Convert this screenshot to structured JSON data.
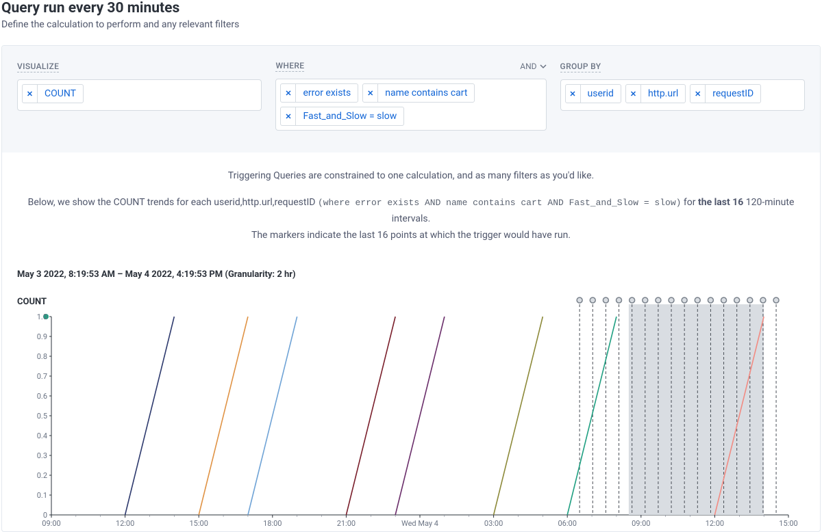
{
  "header": {
    "title": "Query run every 30 minutes",
    "subtitle": "Define the calculation to perform and any relevant filters"
  },
  "query": {
    "visualize_label": "VISUALIZE",
    "where_label": "WHERE",
    "where_op": "AND",
    "group_by_label": "GROUP BY",
    "visualize": [
      {
        "label": "COUNT"
      }
    ],
    "where": [
      {
        "label": "error exists"
      },
      {
        "label": "name contains cart"
      },
      {
        "label": "Fast_and_Slow = slow"
      }
    ],
    "group_by": [
      {
        "label": "userid"
      },
      {
        "label": "http.url"
      },
      {
        "label": "requestID"
      }
    ]
  },
  "explain": {
    "line1": "Triggering Queries are constrained to one calculation, and as many filters as you'd like.",
    "line2_pre": "Below, we show the COUNT trends for each userid,http.url,requestID ",
    "line2_mono": "(where error exists AND name contains cart AND Fast_and_Slow = slow)",
    "line2_mid": "  for ",
    "line2_bold": "the last 16",
    "line2_post": " 120-minute intervals.",
    "line3": "The markers indicate the last 16 points at which the trigger would have run."
  },
  "chart": {
    "range_label": "May 3 2022, 8:19:53 AM – May 4 2022, 4:19:53 PM (Granularity: 2 hr)",
    "y_title": "COUNT",
    "y_ticks": [
      "0",
      "0.1",
      "0.2",
      "0.3",
      "0.4",
      "0.5",
      "0.6",
      "0.7",
      "0.8",
      "0.9",
      "1.0"
    ],
    "x_ticks": [
      "09:00",
      "12:00",
      "15:00",
      "18:00",
      "21:00",
      "Wed May 4",
      "03:00",
      "06:00",
      "09:00",
      "12:00",
      "15:00"
    ]
  },
  "chart_data": {
    "type": "line",
    "title": "COUNT",
    "ylabel": "COUNT",
    "xlabel": "",
    "ylim": [
      0,
      1.0
    ],
    "x_range_label": "May 3 2022, 8:19:53 AM – May 4 2022, 4:19:53 PM",
    "granularity": "2 hr",
    "x_tick_labels": [
      "09:00",
      "12:00",
      "15:00",
      "18:00",
      "21:00",
      "Wed May 4",
      "03:00",
      "06:00",
      "09:00",
      "12:00",
      "15:00"
    ],
    "series": [
      {
        "color": "#2e3a6e",
        "x0": "12:00",
        "y0": 0,
        "x1": "14:00",
        "y1": 1
      },
      {
        "color": "#e09345",
        "x0": "15:00",
        "y0": 0,
        "x1": "17:00",
        "y1": 1
      },
      {
        "color": "#6fa3d6",
        "x0": "17:00",
        "y0": 0,
        "x1": "19:00",
        "y1": 1
      },
      {
        "color": "#7a1f2b",
        "x0": "21:00",
        "y0": 0,
        "x1": "23:00",
        "y1": 1
      },
      {
        "color": "#6b2f6b",
        "x0": "23:00",
        "y0": 0,
        "x1": "Wed May 4 01:00",
        "y1": 1
      },
      {
        "color": "#8d8a3a",
        "x0": "Wed May 4 03:00",
        "y0": 0,
        "x1": "Wed May 4 05:00",
        "y1": 1
      },
      {
        "color": "#1f9f81",
        "x0": "Wed May 4 06:00",
        "y0": 0,
        "x1": "Wed May 4 08:00",
        "y1": 1
      },
      {
        "color": "#f28b82",
        "x0": "Wed May 4 12:00",
        "y0": 0,
        "x1": "Wed May 4 14:00",
        "y1": 1
      }
    ],
    "trigger_marker_count": 16,
    "trigger_region": {
      "start": "Wed May 4 06:30",
      "end": "Wed May 4 14:30"
    },
    "shaded_region": {
      "start": "Wed May 4 08:30",
      "end": "Wed May 4 14:00"
    }
  }
}
